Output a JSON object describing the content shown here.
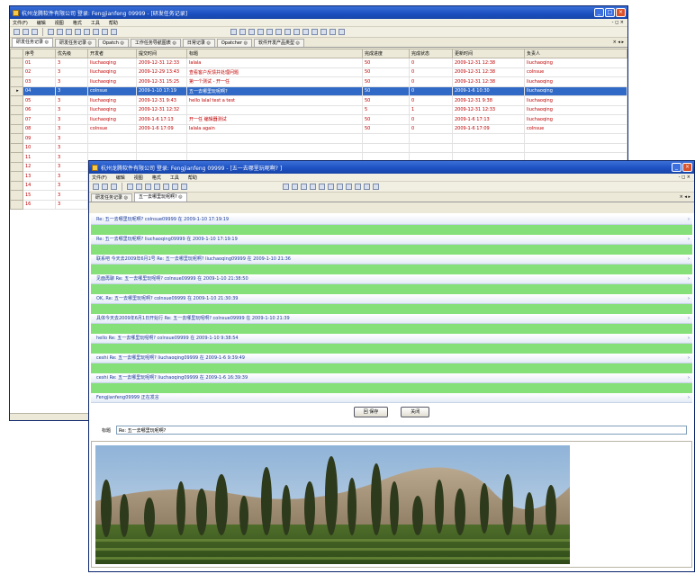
{
  "back_window": {
    "title": "杭州龙腾软件有限公司 登录: Fengjianfeng 09999 - [研发任务记录]",
    "menu": [
      "文件(F)",
      "编辑",
      "视图",
      "格式",
      "工具",
      "帮助"
    ],
    "mdi_controls": "- ◻ ×",
    "tabs": [
      "研发任务记录 ◎",
      "研发任务记录 ◎",
      "Opatch ◎",
      "工作任务导航图表 ◎",
      "日常记录 ◎",
      "Opatcher ◎",
      "软件开发产品类型 ◎"
    ],
    "tab_close": "× ◂ ▸",
    "columns": [
      "序号",
      "优先级",
      "开发者",
      "提交时间",
      "标题",
      "完成进度",
      "完成状态",
      "更新时间",
      "负责人"
    ],
    "rows": [
      {
        "marker": "",
        "cells": [
          "01",
          "3",
          "liuchaoqing",
          "2009-12-31 12:33",
          "lalala",
          "50",
          "0",
          "2009-12-31 12:38",
          "liuchaoqing"
        ]
      },
      {
        "marker": "",
        "cells": [
          "02",
          "3",
          "liuchaoqing",
          "2009-12-29 13:43",
          "查看客户反馈并处理问题",
          "50",
          "0",
          "2009-12-31 12:38",
          "colnsue"
        ]
      },
      {
        "marker": "",
        "cells": [
          "03",
          "3",
          "liuchaoqing",
          "2009-12-31 15:25",
          "第一个测试 - 开一任",
          "50",
          "0",
          "2009-12-31 12:38",
          "liuchaoqing"
        ]
      },
      {
        "marker": "▸",
        "cells": [
          "04",
          "3",
          "colnsue",
          "2009-1-10 17:19",
          "五一去哪里玩呢啊?",
          "50",
          "0",
          "2009-1-6 10:30",
          "liuchaoqing"
        ],
        "selected": true
      },
      {
        "marker": "",
        "cells": [
          "05",
          "3",
          "liuchaoqing",
          "2009-12-31 9:43",
          "hello lalal test a test",
          "50",
          "0",
          "2009-12-31 9:38",
          "liuchaoqing"
        ]
      },
      {
        "marker": "",
        "cells": [
          "06",
          "3",
          "liuchaoqing",
          "2009-12-31 12:32",
          "",
          "5",
          "1",
          "2009-12-31 12:33",
          "liuchaoqing"
        ]
      },
      {
        "marker": "",
        "cells": [
          "07",
          "3",
          "liuchaoqing",
          "2009-1-6 17:13",
          "开一任 编辑器测试",
          "50",
          "0",
          "2009-1-6 17:13",
          "liuchaoqing"
        ]
      },
      {
        "marker": "",
        "cells": [
          "08",
          "3",
          "colnsue",
          "2009-1-6 17:09",
          "lalala again",
          "50",
          "0",
          "2009-1-6 17:09",
          "colnsue"
        ]
      },
      {
        "marker": "",
        "cells": [
          "09",
          "3",
          "",
          "",
          "",
          "",
          "",
          "",
          ""
        ]
      },
      {
        "marker": "",
        "cells": [
          "10",
          "3",
          "",
          "",
          "",
          "",
          "",
          "",
          ""
        ]
      },
      {
        "marker": "",
        "cells": [
          "11",
          "3",
          "",
          "",
          "",
          "",
          "",
          "",
          ""
        ]
      },
      {
        "marker": "",
        "cells": [
          "12",
          "3",
          "",
          "",
          "",
          "",
          "",
          "",
          ""
        ]
      },
      {
        "marker": "",
        "cells": [
          "13",
          "3",
          "",
          "",
          "",
          "",
          "",
          "",
          ""
        ]
      },
      {
        "marker": "",
        "cells": [
          "14",
          "3",
          "",
          "",
          "",
          "",
          "",
          "",
          ""
        ]
      },
      {
        "marker": "",
        "cells": [
          "15",
          "3",
          "",
          "",
          "",
          "",
          "",
          "",
          ""
        ]
      },
      {
        "marker": "",
        "cells": [
          "16",
          "3",
          "",
          "",
          "",
          "",
          "",
          "",
          ""
        ]
      }
    ]
  },
  "front_window": {
    "title": "杭州龙腾软件有限公司 登录: Fengjianfeng 09999 - [五一去哪里玩呢啊? ]",
    "menu": [
      "文件(F)",
      "编辑",
      "视图",
      "格式",
      "工具",
      "帮助"
    ],
    "mdi_controls": "- ◻ ×",
    "tabs": [
      "研发任务记录 ◎",
      "五一去哪里玩呢啊? ◎"
    ],
    "tab_close": "× ◂ ▸",
    "posts": [
      "Re: 五一去哪里玩呢啊?   colnsue09999   在 2009-1-10 17:19:19",
      "Re: 五一去哪里玩呢啊?   liuchaoqing09999   在 2009-1-10 17:19:19",
      "联系吧 今天去2009年6月1号 Re: 五一去哪里玩呢啊?   liuchaoqing09999   在 2009-1-10 21:36",
      "见面再聊  Re: 五一去哪里玩呢啊?   colnsue09999   在 2009-1-10 21:38:50",
      "OK, Re: 五一去哪里玩呢啊?   colnsue09999   在 2009-1-10 21:30:39",
      "具体今天去2009年6月1日开始行 Re: 五一去哪里玩呢啊?   colnsue09999   在 2009-1-10 21:39",
      "hello Re: 五一去哪里玩呢啊?   colnsue09999   在 2009-1-10 9:38:54",
      "ceshi Re: 五一去哪里玩呢啊?   liuchaoqing09999   在 2009-1-6 9:39:49",
      "ceshi Re: 五一去哪里玩呢啊?   liuchaoqing09999   在 2009-1-6 16:39:39",
      "Fengjianfeng09999 正在发言"
    ],
    "post_arrow": "›",
    "reply_button": "回 保存",
    "close_button": "关闭",
    "title_label": "标题",
    "title_value": "Re: 五一去哪里玩呢啊?"
  },
  "colors": {
    "title_blue": "#1c4fc0",
    "selected_row": "#3169c6",
    "row_text_red": "#c00000",
    "post_text_blue": "#1a3a9a",
    "stripe_green": "#86e07a"
  }
}
